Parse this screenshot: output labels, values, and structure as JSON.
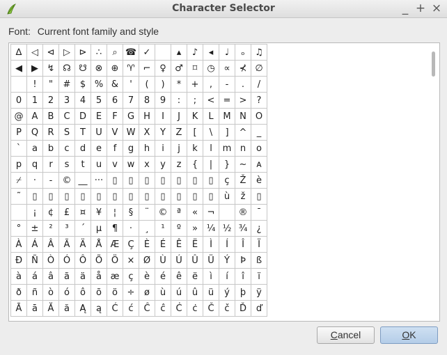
{
  "window": {
    "title": "Character Selector",
    "minimize": "_",
    "maximize": "+",
    "close": "×"
  },
  "font": {
    "label": "Font:",
    "value": "Current font family and style"
  },
  "rows": [
    [
      "∆",
      "◁",
      "⊲",
      "▷",
      "⊳",
      "∴",
      "⌕",
      "☎",
      "✓",
      "",
      "▴",
      "♪",
      "◂",
      "♩",
      "ₒ",
      "♫"
    ],
    [
      "◀",
      "▶",
      "↯",
      "☊",
      "☋",
      "⊗",
      "⊕",
      "♈",
      "⌐",
      "♀",
      "♂",
      "⌑",
      "◷",
      "∝",
      "⊀",
      "∅"
    ],
    [
      "",
      "!",
      "\"",
      "#",
      "$",
      "%",
      "&",
      "'",
      "(",
      ")",
      "*",
      "+",
      ",",
      "-",
      ".",
      "/"
    ],
    [
      "0",
      "1",
      "2",
      "3",
      "4",
      "5",
      "6",
      "7",
      "8",
      "9",
      ":",
      ";",
      "<",
      "=",
      ">",
      "?"
    ],
    [
      "@",
      "A",
      "B",
      "C",
      "D",
      "E",
      "F",
      "G",
      "H",
      "I",
      "J",
      "K",
      "L",
      "M",
      "N",
      "O"
    ],
    [
      "P",
      "Q",
      "R",
      "S",
      "T",
      "U",
      "V",
      "W",
      "X",
      "Y",
      "Z",
      "[",
      "\\",
      "]",
      "^",
      "_"
    ],
    [
      "`",
      "a",
      "b",
      "c",
      "d",
      "e",
      "f",
      "g",
      "h",
      "i",
      "j",
      "k",
      "l",
      "m",
      "n",
      "o"
    ],
    [
      "p",
      "q",
      "r",
      "s",
      "t",
      "u",
      "v",
      "w",
      "x",
      "y",
      "z",
      "{",
      "|",
      "}",
      "~",
      "ᴀ"
    ],
    [
      "⌿",
      "·",
      "-",
      "©",
      "__",
      "···",
      "▯",
      "▯",
      "▯",
      "▯",
      "▯",
      "▯",
      "▯",
      "ç",
      "Ž",
      "è"
    ],
    [
      "˜",
      "▯",
      "▯",
      "▯",
      "▯",
      "▯",
      "▯",
      "▯",
      "▯",
      "▯",
      "▯",
      "▯",
      "▯",
      "ù",
      "ž",
      "▯"
    ],
    [
      "",
      "¡",
      "¢",
      "£",
      "¤",
      "¥",
      "¦",
      "§",
      "¨",
      "©",
      "ª",
      "«",
      "¬",
      "",
      "®",
      "¯"
    ],
    [
      "°",
      "±",
      "²",
      "³",
      "´",
      "µ",
      "¶",
      "·",
      "¸",
      "¹",
      "º",
      "»",
      "¼",
      "½",
      "¾",
      "¿"
    ],
    [
      "À",
      "Á",
      "Â",
      "Ã",
      "Ä",
      "Å",
      "Æ",
      "Ç",
      "È",
      "É",
      "Ê",
      "Ë",
      "Ì",
      "Í",
      "Î",
      "Ï"
    ],
    [
      "Ð",
      "Ñ",
      "Ò",
      "Ó",
      "Ô",
      "Õ",
      "Ö",
      "×",
      "Ø",
      "Ù",
      "Ú",
      "Û",
      "Ü",
      "Ý",
      "Þ",
      "ß"
    ],
    [
      "à",
      "á",
      "â",
      "ã",
      "ä",
      "å",
      "æ",
      "ç",
      "è",
      "é",
      "ê",
      "ë",
      "ì",
      "í",
      "î",
      "ï"
    ],
    [
      "ð",
      "ñ",
      "ò",
      "ó",
      "ô",
      "õ",
      "ö",
      "÷",
      "ø",
      "ù",
      "ú",
      "û",
      "ü",
      "ý",
      "þ",
      "ÿ"
    ],
    [
      "Ā",
      "ā",
      "Ă",
      "ă",
      "Ą",
      "ą",
      "Ć",
      "ć",
      "Ĉ",
      "ĉ",
      "Ċ",
      "ċ",
      "Č",
      "č",
      "Ď",
      "ď"
    ]
  ],
  "buttons": {
    "cancel": {
      "mnemonic": "C",
      "rest": "ancel"
    },
    "ok": {
      "mnemonic": "O",
      "rest": "K"
    }
  }
}
